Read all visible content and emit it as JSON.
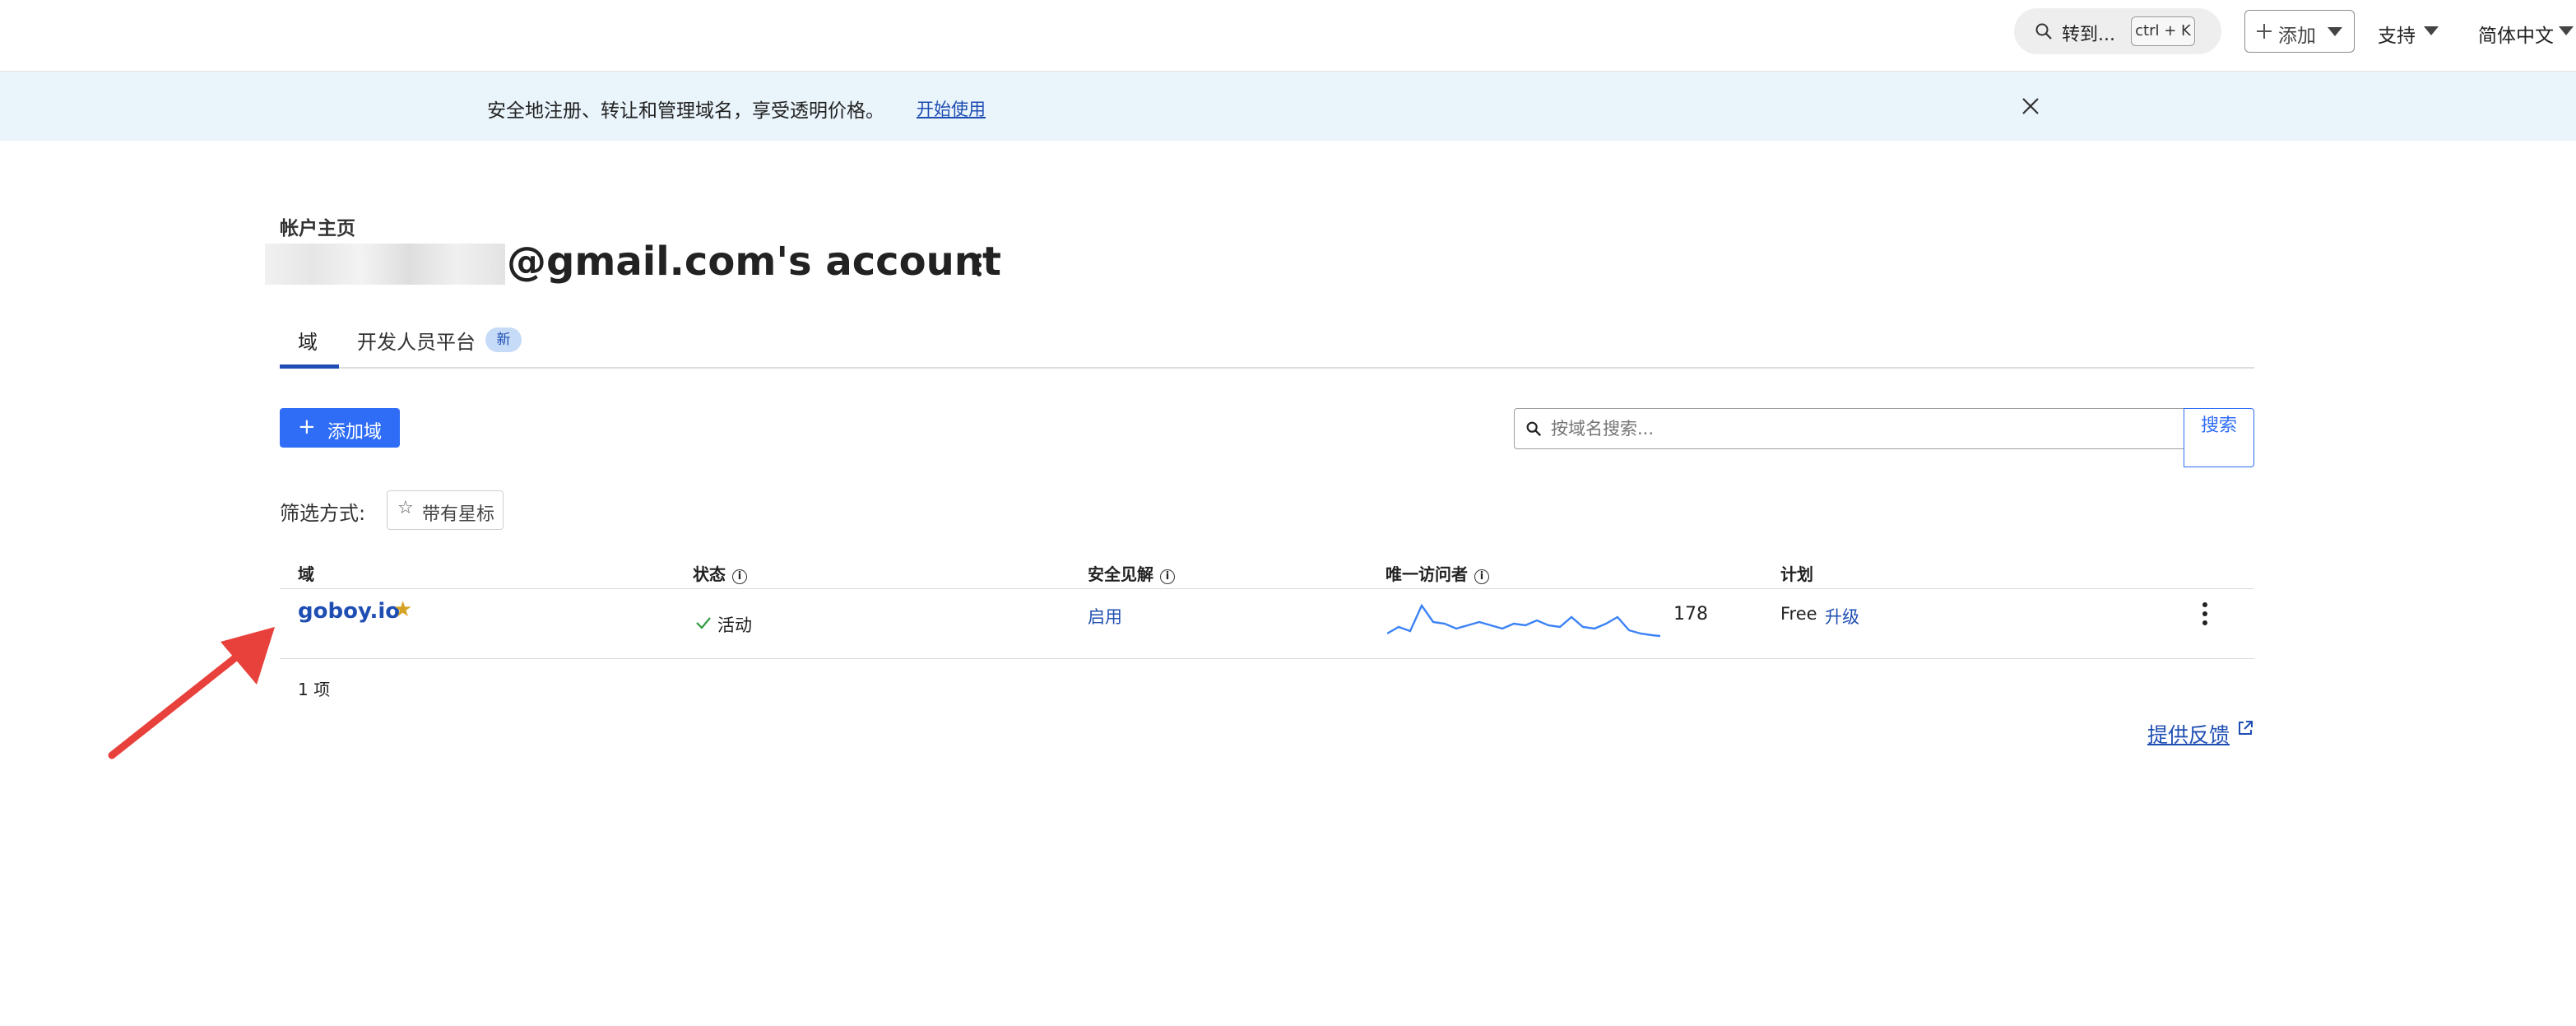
{
  "topbar": {
    "goto_label": "转到...",
    "goto_shortcut": "ctrl + K",
    "add_label": "添加",
    "support_label": "支持",
    "language_label": "简体中文"
  },
  "banner": {
    "message": "安全地注册、转让和管理域名，享受透明价格。",
    "start_link": "开始使用"
  },
  "header": {
    "breadcrumb": "帐户主页",
    "account_title": "@gmail.com's account"
  },
  "tabs": [
    {
      "label": "域",
      "active": true
    },
    {
      "label": "开发人员平台",
      "badge": "新"
    }
  ],
  "actions": {
    "add_domain_label": "添加域",
    "search_placeholder": "按域名搜索...",
    "search_button": "搜索"
  },
  "filter": {
    "label": "筛选方式:",
    "starred_label": "带有星标"
  },
  "table": {
    "headers": {
      "domain": "域",
      "status": "状态",
      "security": "安全见解",
      "visitors": "唯一访问者",
      "plan": "计划"
    },
    "rows": [
      {
        "domain": "goboy.io",
        "starred": true,
        "status": "活动",
        "security": "启用",
        "visitors": "178",
        "plan": "Free",
        "upgrade": "升级"
      }
    ],
    "count_label": "1 项"
  },
  "footer": {
    "feedback": "提供反馈"
  },
  "colors": {
    "accent": "#2f6df6",
    "link": "#1f4eb3",
    "banner_bg": "#e9f4fb",
    "annotation_arrow": "#e8403b"
  }
}
